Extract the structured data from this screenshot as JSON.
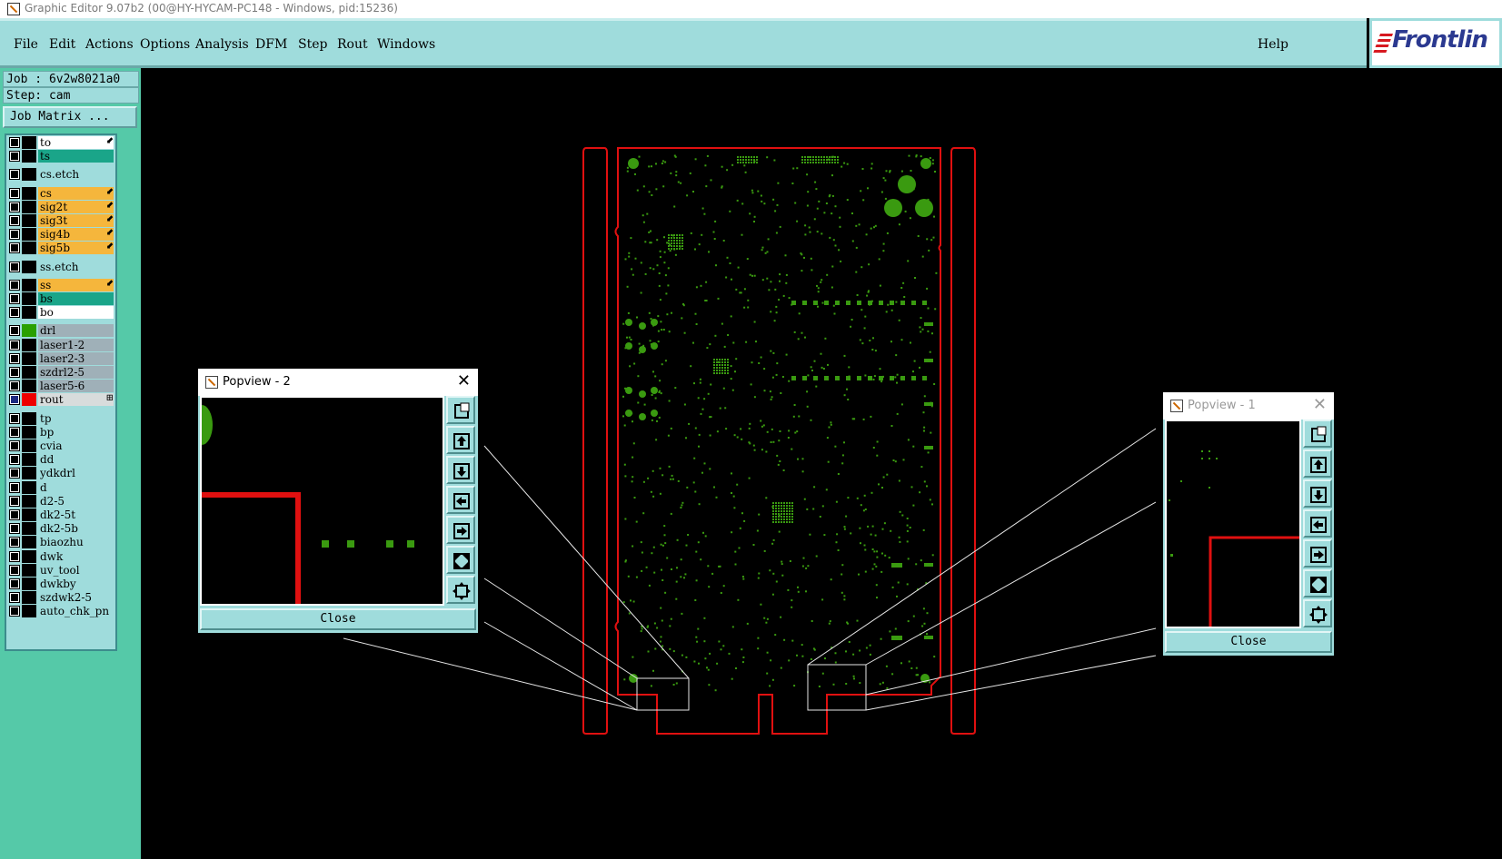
{
  "window": {
    "title": "Graphic Editor 9.07b2 (00@HY-HYCAM-PC148 - Windows, pid:15236)"
  },
  "menu": {
    "file": "File",
    "edit": "Edit",
    "actions": "Actions",
    "options": "Options",
    "analysis": "Analysis",
    "dfm": "DFM",
    "step": "Step",
    "rout": "Rout",
    "windows": "Windows",
    "help": "Help"
  },
  "logo": {
    "text": "Frontlin"
  },
  "job": {
    "job_line": "Job : 6v2w8021a0",
    "step_line": "Step: cam",
    "matrix_button": "Job Matrix ..."
  },
  "layers": [
    {
      "name": "to",
      "bg": "#ffffff",
      "color": "#000000",
      "mark": "⬋"
    },
    {
      "name": "ts",
      "bg": "#1aa589",
      "color": "#000000",
      "mark": ""
    },
    {
      "name": "cs.etch",
      "bg": "#9fdcdc",
      "color": "#000000",
      "mark": ""
    },
    {
      "name": "cs",
      "bg": "#f5b63c",
      "color": "#000000",
      "mark": "⬋"
    },
    {
      "name": "sig2t",
      "bg": "#f5b63c",
      "color": "#000000",
      "mark": "⬋"
    },
    {
      "name": "sig3t",
      "bg": "#f5b63c",
      "color": "#000000",
      "mark": "⬋"
    },
    {
      "name": "sig4b",
      "bg": "#f5b63c",
      "color": "#000000",
      "mark": "⬋"
    },
    {
      "name": "sig5b",
      "bg": "#f5b63c",
      "color": "#000000",
      "mark": "⬋"
    },
    {
      "name": "ss.etch",
      "bg": "#9fdcdc",
      "color": "#000000",
      "mark": ""
    },
    {
      "name": "ss",
      "bg": "#f5b63c",
      "color": "#000000",
      "mark": "⬋"
    },
    {
      "name": "bs",
      "bg": "#1aa589",
      "color": "#000000",
      "mark": ""
    },
    {
      "name": "bo",
      "bg": "#ffffff",
      "color": "#000000",
      "mark": ""
    },
    {
      "name": "drl",
      "bg": "#9fb0b8",
      "color": "#2aa000",
      "mark": ""
    },
    {
      "name": "laser1-2",
      "bg": "#9fb0b8",
      "color": "#000000",
      "mark": ""
    },
    {
      "name": "laser2-3",
      "bg": "#9fb0b8",
      "color": "#000000",
      "mark": ""
    },
    {
      "name": "szdrl2-5",
      "bg": "#9fb0b8",
      "color": "#000000",
      "mark": ""
    },
    {
      "name": "laser5-6",
      "bg": "#9fb0b8",
      "color": "#000000",
      "mark": ""
    },
    {
      "name": "rout",
      "bg": "#d8dcdc",
      "color": "#ee0000",
      "mark": "⊞"
    },
    {
      "name": "tp",
      "bg": "#9fdcdc",
      "color": "#000000",
      "mark": ""
    },
    {
      "name": "bp",
      "bg": "#9fdcdc",
      "color": "#000000",
      "mark": ""
    },
    {
      "name": "cvia",
      "bg": "#9fdcdc",
      "color": "#000000",
      "mark": ""
    },
    {
      "name": "dd",
      "bg": "#9fdcdc",
      "color": "#000000",
      "mark": ""
    },
    {
      "name": "ydkdrl",
      "bg": "#9fdcdc",
      "color": "#000000",
      "mark": ""
    },
    {
      "name": "d",
      "bg": "#9fdcdc",
      "color": "#000000",
      "mark": ""
    },
    {
      "name": "d2-5",
      "bg": "#9fdcdc",
      "color": "#000000",
      "mark": ""
    },
    {
      "name": "dk2-5t",
      "bg": "#9fdcdc",
      "color": "#000000",
      "mark": ""
    },
    {
      "name": "dk2-5b",
      "bg": "#9fdcdc",
      "color": "#000000",
      "mark": ""
    },
    {
      "name": "biaozhu",
      "bg": "#9fdcdc",
      "color": "#000000",
      "mark": ""
    },
    {
      "name": "dwk",
      "bg": "#9fdcdc",
      "color": "#000000",
      "mark": ""
    },
    {
      "name": "uv_tool",
      "bg": "#9fdcdc",
      "color": "#000000",
      "mark": ""
    },
    {
      "name": "dwkby",
      "bg": "#9fdcdc",
      "color": "#000000",
      "mark": ""
    },
    {
      "name": "szdwk2-5",
      "bg": "#9fdcdc",
      "color": "#000000",
      "mark": ""
    },
    {
      "name": "auto_chk_pn",
      "bg": "#9fdcdc",
      "color": "#000000",
      "mark": ""
    }
  ],
  "popview2": {
    "title": "Popview - 2",
    "close": "Close"
  },
  "popview1": {
    "title": "Popview - 1",
    "close": "Close"
  },
  "colors": {
    "board_outline": "#e01010",
    "pads": "#3a9a10",
    "rout_line": "#e01010"
  },
  "icons": [
    "zoom-fit-icon",
    "pan-up-icon",
    "pan-down-icon",
    "pan-left-icon",
    "pan-right-icon",
    "zoom-out-icon",
    "zoom-in-icon",
    "close-x-icon"
  ]
}
